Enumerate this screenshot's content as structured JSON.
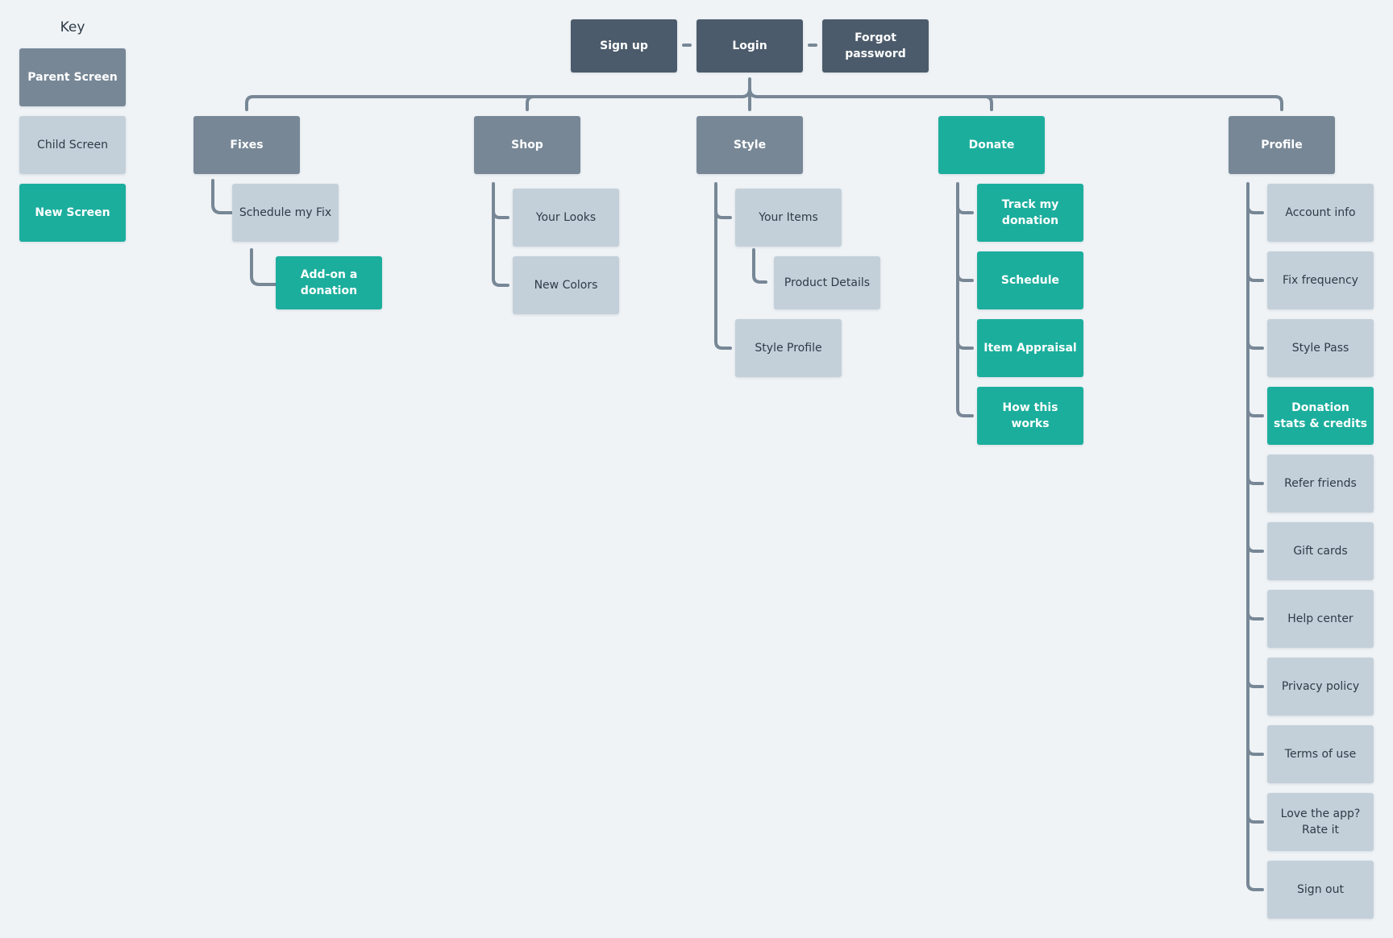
{
  "key": {
    "title": "Key",
    "items": [
      {
        "label": "Parent Screen",
        "type": "parent"
      },
      {
        "label": "Child Screen",
        "type": "child"
      },
      {
        "label": "New Screen",
        "type": "new"
      }
    ]
  },
  "colors": {
    "background": "#eff3f6",
    "nav": "#4b5b6b",
    "parent": "#778796",
    "child": "#c4d0d9",
    "new": "#1cae9d",
    "connector": "#778796"
  },
  "auth": {
    "signup": "Sign up",
    "login": "Login",
    "forgot": "Forgot password"
  },
  "sections": {
    "fixes": {
      "label": "Fixes",
      "type": "parent",
      "children": [
        {
          "label": "Schedule my Fix",
          "type": "child"
        },
        {
          "label": "Add-on a donation",
          "type": "new"
        }
      ]
    },
    "shop": {
      "label": "Shop",
      "type": "parent",
      "children": [
        {
          "label": "Your Looks",
          "type": "child"
        },
        {
          "label": "New Colors",
          "type": "child"
        }
      ]
    },
    "style": {
      "label": "Style",
      "type": "parent",
      "children": [
        {
          "label": "Your Items",
          "type": "child"
        },
        {
          "label": "Product Details",
          "type": "child"
        },
        {
          "label": "Style Profile",
          "type": "child"
        }
      ]
    },
    "donate": {
      "label": "Donate",
      "type": "new",
      "children": [
        {
          "label": "Track my donation",
          "type": "new"
        },
        {
          "label": "Schedule",
          "type": "new"
        },
        {
          "label": "Item Appraisal",
          "type": "new"
        },
        {
          "label": "How this works",
          "type": "new"
        }
      ]
    },
    "profile": {
      "label": "Profile",
      "type": "parent",
      "children": [
        {
          "label": "Account info",
          "type": "child"
        },
        {
          "label": "Fix frequency",
          "type": "child"
        },
        {
          "label": "Style Pass",
          "type": "child"
        },
        {
          "label": "Donation stats & credits",
          "type": "new"
        },
        {
          "label": "Refer friends",
          "type": "child"
        },
        {
          "label": "Gift cards",
          "type": "child"
        },
        {
          "label": "Help center",
          "type": "child"
        },
        {
          "label": "Privacy policy",
          "type": "child"
        },
        {
          "label": "Terms of use",
          "type": "child"
        },
        {
          "label": "Love the app? Rate it",
          "type": "child"
        },
        {
          "label": "Sign out",
          "type": "child"
        }
      ]
    }
  }
}
